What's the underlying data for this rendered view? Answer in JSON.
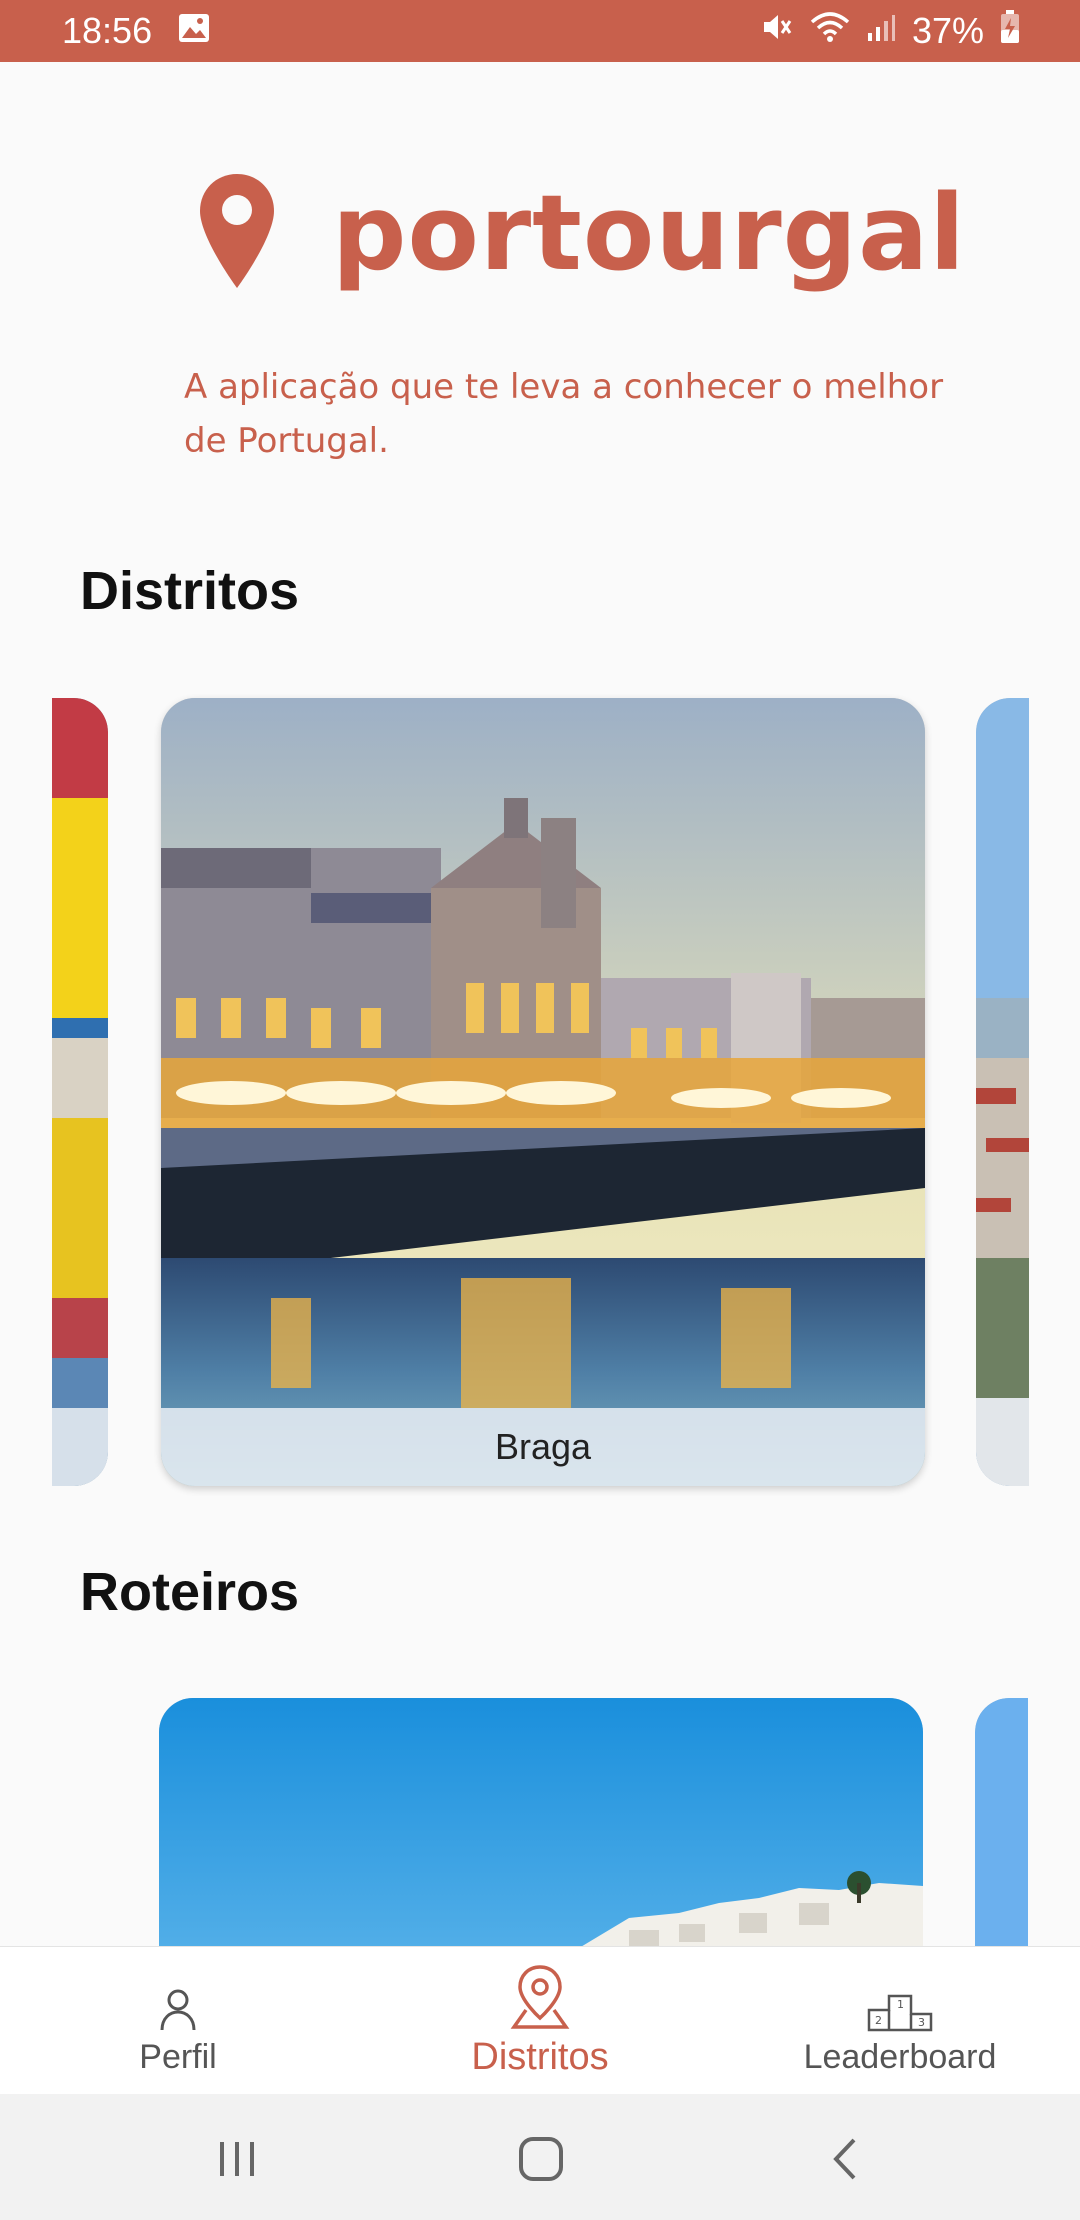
{
  "status_bar": {
    "time": "18:56",
    "battery": "37%",
    "icons": [
      "image-icon",
      "mute-icon",
      "wifi-icon",
      "signal-icon",
      "battery-charging-icon"
    ]
  },
  "app": {
    "name": "portourgal",
    "tagline": "A aplicação que te leva a conhecer o melhor de Portugal.",
    "accent_color": "#c8604c"
  },
  "sections": {
    "distritos": {
      "title": "Distritos",
      "cards": [
        {
          "label": "",
          "image": "colorful-houses-photo"
        },
        {
          "label": "Braga",
          "image": "braga-square-photo"
        },
        {
          "label": "",
          "image": "hillside-town-photo"
        }
      ]
    },
    "roteiros": {
      "title": "Roteiros",
      "cards": [
        {
          "image": "coastal-village-photo"
        },
        {
          "image": "sky-photo"
        }
      ]
    }
  },
  "bottom_nav": {
    "items": [
      {
        "label": "Perfil",
        "icon": "person-icon",
        "active": false
      },
      {
        "label": "Distritos",
        "icon": "map-pin-icon",
        "active": true
      },
      {
        "label": "Leaderboard",
        "icon": "podium-icon",
        "active": false
      }
    ]
  },
  "system_nav": {
    "buttons": [
      "recents-button",
      "home-button",
      "back-button"
    ]
  }
}
